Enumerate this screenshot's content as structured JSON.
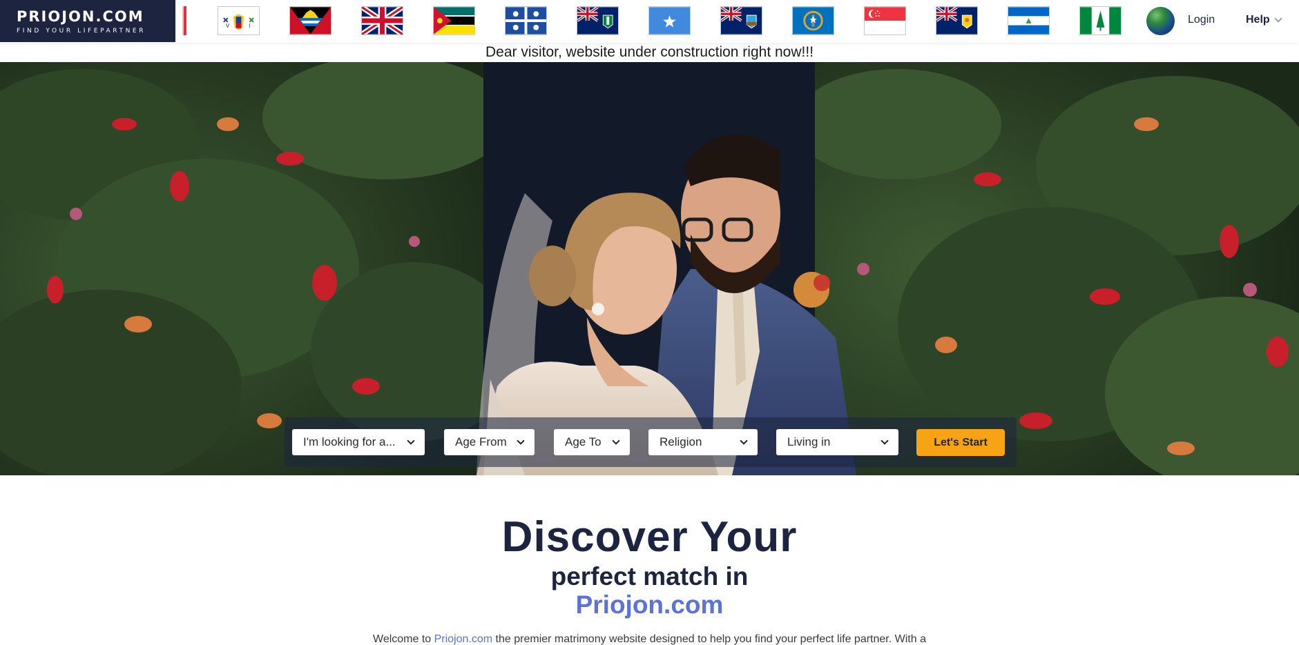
{
  "header": {
    "logo_title": "PRIOJON.COM",
    "logo_tagline": "FIND YOUR LIFEPARTNER",
    "flags": [
      "us-virgin-islands-flag",
      "antigua-and-barbuda-flag",
      "united-kingdom-flag",
      "mozambique-flag",
      "martinique-flag",
      "british-virgin-islands-flag",
      "somalia-flag",
      "montserrat-flag",
      "northern-mariana-islands-flag",
      "singapore-flag",
      "turks-and-caicos-flag",
      "nicaragua-flag",
      "norfolk-island-flag"
    ],
    "login_label": "Login",
    "help_label": "Help"
  },
  "notice": "Dear visitor, website under construction right now!!!",
  "search": {
    "looking_for": "I'm looking for a...",
    "age_from": "Age From",
    "age_to": "Age To",
    "religion": "Religion",
    "living_in": "Living in",
    "start_label": "Let's Start"
  },
  "discover": {
    "line1": "Discover Your",
    "line2": "perfect match in",
    "line3": "Priojon.com",
    "intro_before": "Welcome to ",
    "intro_link": "Priojon.com",
    "intro_after": " the premier matrimony website designed to help you find your perfect life partner. With a"
  },
  "colors": {
    "navy": "#1c2440",
    "accent_orange": "#f8a314",
    "link_blue": "#5b72d9"
  }
}
